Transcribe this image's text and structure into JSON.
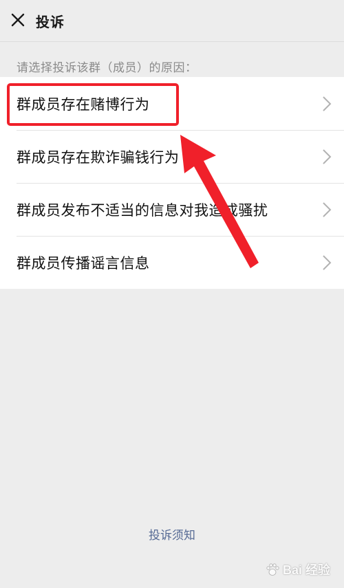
{
  "header": {
    "title": "投诉",
    "close_icon": "close-icon"
  },
  "subtitle": "请选择投诉该群（成员）的原因：",
  "reasons": [
    {
      "label": "群成员存在赌博行为"
    },
    {
      "label": "群成员存在欺诈骗钱行为"
    },
    {
      "label": "群成员发布不适当的信息对我造成骚扰"
    },
    {
      "label": "群成员传播谣言信息"
    }
  ],
  "footer": {
    "link": "投诉须知"
  },
  "annotation": {
    "highlight_color": "#f0202a"
  },
  "watermark": {
    "text": "Bai 经验"
  },
  "colors": {
    "background": "#ededed",
    "link": "#576b95",
    "subtitle": "#8a8a8a"
  }
}
